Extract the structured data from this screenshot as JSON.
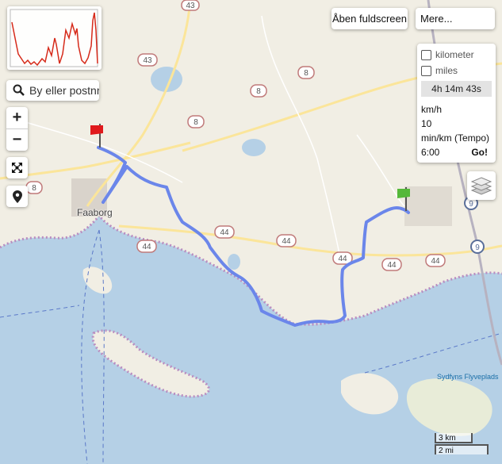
{
  "toolbar": {
    "fullscreen_label": "Åben fuldscreen",
    "more_label": "Mere..."
  },
  "search": {
    "placeholder": "By eller postnr"
  },
  "zoom": {
    "in_label": "+",
    "out_label": "−"
  },
  "units_panel": {
    "option_km": "kilometer",
    "option_miles": "miles",
    "duration": "4h 14m 43s",
    "speed_label": "km/h",
    "speed_value": "10",
    "pace_label": "min/km (Tempo)",
    "pace_value": "6:00",
    "go_label": "Go!"
  },
  "scale": {
    "metric": "3 km",
    "imperial": "2 mi"
  },
  "map": {
    "place_label": "Faaborg",
    "poi_label": "Sydfyns Flyveplads",
    "road_shields": [
      "43",
      "43",
      "8",
      "8",
      "8",
      "8",
      "44",
      "44",
      "44",
      "44",
      "44",
      "44",
      "9",
      "9"
    ],
    "route_color": "#6b86ea",
    "water_color": "#b5d0e6",
    "land_color": "#f1eee4",
    "start_flag_color": "#e0191c",
    "end_flag_color": "#55b83a"
  },
  "elevation_profile": {
    "line_color": "#d62a1a"
  },
  "icons": {
    "search": "magnifier-icon",
    "fit": "fit-bounds-icon",
    "locate": "map-pin-icon",
    "layers": "layers-stack-icon"
  }
}
